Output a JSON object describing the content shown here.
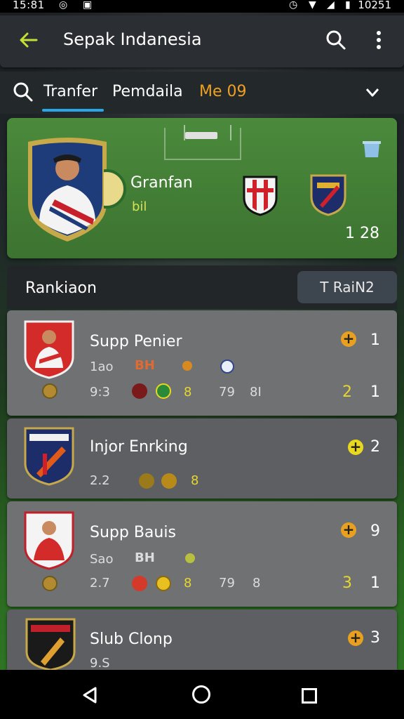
{
  "status": {
    "time": "15:81",
    "battery": "10251"
  },
  "appbar": {
    "title": "Sepak Indanesia"
  },
  "tabs": [
    {
      "label": "Tranfer",
      "active": true
    },
    {
      "label": "Pemdaila",
      "active": false
    },
    {
      "label": "Me 09",
      "active": false,
      "color": "#f0a020"
    }
  ],
  "hero": {
    "player_name": "Granfan",
    "player_code": "bil",
    "score": "1 28"
  },
  "ranking": {
    "title": "Rankiaon",
    "button_label": "T RaiN2"
  },
  "rows": [
    {
      "name": "Supp Penier",
      "line1": "1ao",
      "line1_tag": "BH",
      "line2": "9:3",
      "line2_val": "8",
      "line2_extra": "79",
      "line2_extra2": "8I",
      "rank": "1",
      "rank2": "1",
      "side_val": "2"
    },
    {
      "name": "Injor Enrking",
      "line2": "2.2",
      "line2_val": "8",
      "rank": "2"
    },
    {
      "name": "Supp Bauis",
      "line1": "Sao",
      "line1_tag": "BH",
      "line2": "2.7",
      "line2_val": "8",
      "line2_extra": "79",
      "line2_extra2": "8",
      "rank": "9",
      "rank2": "1",
      "side_val": "3"
    },
    {
      "name": "Slub Clonp",
      "line1": "9.S",
      "rank": "3"
    }
  ],
  "colors": {
    "accent": "#2aa6e8",
    "pitch": "#3c7330",
    "gold": "#e7d62f"
  }
}
